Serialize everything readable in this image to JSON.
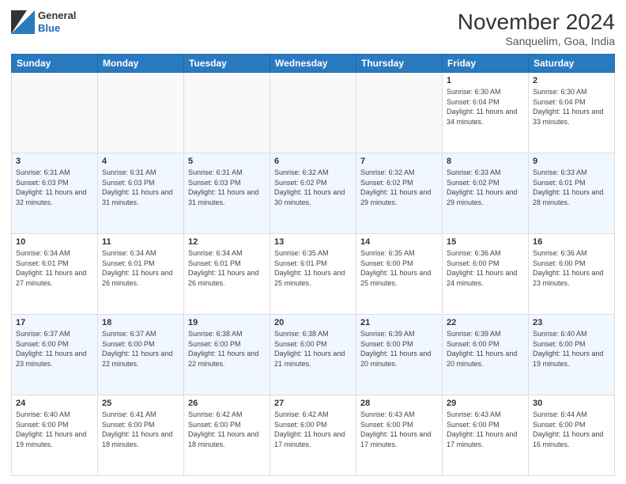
{
  "header": {
    "logo": {
      "line1": "General",
      "line2": "Blue"
    },
    "title": "November 2024",
    "location": "Sanquelim, Goa, India"
  },
  "weekdays": [
    "Sunday",
    "Monday",
    "Tuesday",
    "Wednesday",
    "Thursday",
    "Friday",
    "Saturday"
  ],
  "weeks": [
    [
      {
        "day": "",
        "empty": true
      },
      {
        "day": "",
        "empty": true
      },
      {
        "day": "",
        "empty": true
      },
      {
        "day": "",
        "empty": true
      },
      {
        "day": "",
        "empty": true
      },
      {
        "day": "1",
        "sunrise": "6:30 AM",
        "sunset": "6:04 PM",
        "daylight": "11 hours and 34 minutes."
      },
      {
        "day": "2",
        "sunrise": "6:30 AM",
        "sunset": "6:04 PM",
        "daylight": "11 hours and 33 minutes."
      }
    ],
    [
      {
        "day": "3",
        "sunrise": "6:31 AM",
        "sunset": "6:03 PM",
        "daylight": "11 hours and 32 minutes."
      },
      {
        "day": "4",
        "sunrise": "6:31 AM",
        "sunset": "6:03 PM",
        "daylight": "11 hours and 31 minutes."
      },
      {
        "day": "5",
        "sunrise": "6:31 AM",
        "sunset": "6:03 PM",
        "daylight": "11 hours and 31 minutes."
      },
      {
        "day": "6",
        "sunrise": "6:32 AM",
        "sunset": "6:02 PM",
        "daylight": "11 hours and 30 minutes."
      },
      {
        "day": "7",
        "sunrise": "6:32 AM",
        "sunset": "6:02 PM",
        "daylight": "11 hours and 29 minutes."
      },
      {
        "day": "8",
        "sunrise": "6:33 AM",
        "sunset": "6:02 PM",
        "daylight": "11 hours and 29 minutes."
      },
      {
        "day": "9",
        "sunrise": "6:33 AM",
        "sunset": "6:01 PM",
        "daylight": "11 hours and 28 minutes."
      }
    ],
    [
      {
        "day": "10",
        "sunrise": "6:34 AM",
        "sunset": "6:01 PM",
        "daylight": "11 hours and 27 minutes."
      },
      {
        "day": "11",
        "sunrise": "6:34 AM",
        "sunset": "6:01 PM",
        "daylight": "11 hours and 26 minutes."
      },
      {
        "day": "12",
        "sunrise": "6:34 AM",
        "sunset": "6:01 PM",
        "daylight": "11 hours and 26 minutes."
      },
      {
        "day": "13",
        "sunrise": "6:35 AM",
        "sunset": "6:01 PM",
        "daylight": "11 hours and 25 minutes."
      },
      {
        "day": "14",
        "sunrise": "6:35 AM",
        "sunset": "6:00 PM",
        "daylight": "11 hours and 25 minutes."
      },
      {
        "day": "15",
        "sunrise": "6:36 AM",
        "sunset": "6:00 PM",
        "daylight": "11 hours and 24 minutes."
      },
      {
        "day": "16",
        "sunrise": "6:36 AM",
        "sunset": "6:00 PM",
        "daylight": "11 hours and 23 minutes."
      }
    ],
    [
      {
        "day": "17",
        "sunrise": "6:37 AM",
        "sunset": "6:00 PM",
        "daylight": "11 hours and 23 minutes."
      },
      {
        "day": "18",
        "sunrise": "6:37 AM",
        "sunset": "6:00 PM",
        "daylight": "11 hours and 22 minutes."
      },
      {
        "day": "19",
        "sunrise": "6:38 AM",
        "sunset": "6:00 PM",
        "daylight": "11 hours and 22 minutes."
      },
      {
        "day": "20",
        "sunrise": "6:38 AM",
        "sunset": "6:00 PM",
        "daylight": "11 hours and 21 minutes."
      },
      {
        "day": "21",
        "sunrise": "6:39 AM",
        "sunset": "6:00 PM",
        "daylight": "11 hours and 20 minutes."
      },
      {
        "day": "22",
        "sunrise": "6:39 AM",
        "sunset": "6:00 PM",
        "daylight": "11 hours and 20 minutes."
      },
      {
        "day": "23",
        "sunrise": "6:40 AM",
        "sunset": "6:00 PM",
        "daylight": "11 hours and 19 minutes."
      }
    ],
    [
      {
        "day": "24",
        "sunrise": "6:40 AM",
        "sunset": "6:00 PM",
        "daylight": "11 hours and 19 minutes."
      },
      {
        "day": "25",
        "sunrise": "6:41 AM",
        "sunset": "6:00 PM",
        "daylight": "11 hours and 18 minutes."
      },
      {
        "day": "26",
        "sunrise": "6:42 AM",
        "sunset": "6:00 PM",
        "daylight": "11 hours and 18 minutes."
      },
      {
        "day": "27",
        "sunrise": "6:42 AM",
        "sunset": "6:00 PM",
        "daylight": "11 hours and 17 minutes."
      },
      {
        "day": "28",
        "sunrise": "6:43 AM",
        "sunset": "6:00 PM",
        "daylight": "11 hours and 17 minutes."
      },
      {
        "day": "29",
        "sunrise": "6:43 AM",
        "sunset": "6:00 PM",
        "daylight": "11 hours and 17 minutes."
      },
      {
        "day": "30",
        "sunrise": "6:44 AM",
        "sunset": "6:00 PM",
        "daylight": "11 hours and 16 minutes."
      }
    ]
  ],
  "labels": {
    "sunrise": "Sunrise:",
    "sunset": "Sunset:",
    "daylight": "Daylight:"
  },
  "colors": {
    "header_bg": "#2a7abf",
    "even_row": "#f2f8ff",
    "odd_row": "#ffffff",
    "empty_bg": "#f9f9f9"
  }
}
